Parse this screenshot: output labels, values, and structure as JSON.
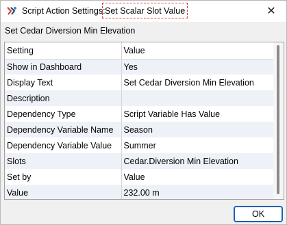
{
  "window": {
    "title_prefix": "Script Action Settings:",
    "title_highlight": "Set Scalar Slot Value",
    "close_glyph": "✕"
  },
  "heading": "Set Cedar Diversion Min Elevation",
  "table": {
    "columns": [
      "Setting",
      "Value"
    ],
    "rows": [
      {
        "setting": "Show in Dashboard",
        "value": "Yes"
      },
      {
        "setting": "Display Text",
        "value": "Set Cedar Diversion Min Elevation"
      },
      {
        "setting": "Description",
        "value": ""
      },
      {
        "setting": "Dependency Type",
        "value": "Script Variable Has Value"
      },
      {
        "setting": "Dependency Variable Name",
        "value": "Season"
      },
      {
        "setting": "Dependency Variable Value",
        "value": "Summer"
      },
      {
        "setting": "Slots",
        "value": "Cedar.Diversion Min Elevation"
      },
      {
        "setting": "Set by",
        "value": "Value"
      },
      {
        "setting": "Value",
        "value": "232.00 m"
      }
    ]
  },
  "buttons": {
    "ok_label": "OK"
  },
  "colors": {
    "highlight_border": "#e0373b",
    "alt_row": "#eef1f7",
    "accent": "#1a5fb4"
  },
  "icons": {
    "app_icon": "riverware-app-icon"
  }
}
